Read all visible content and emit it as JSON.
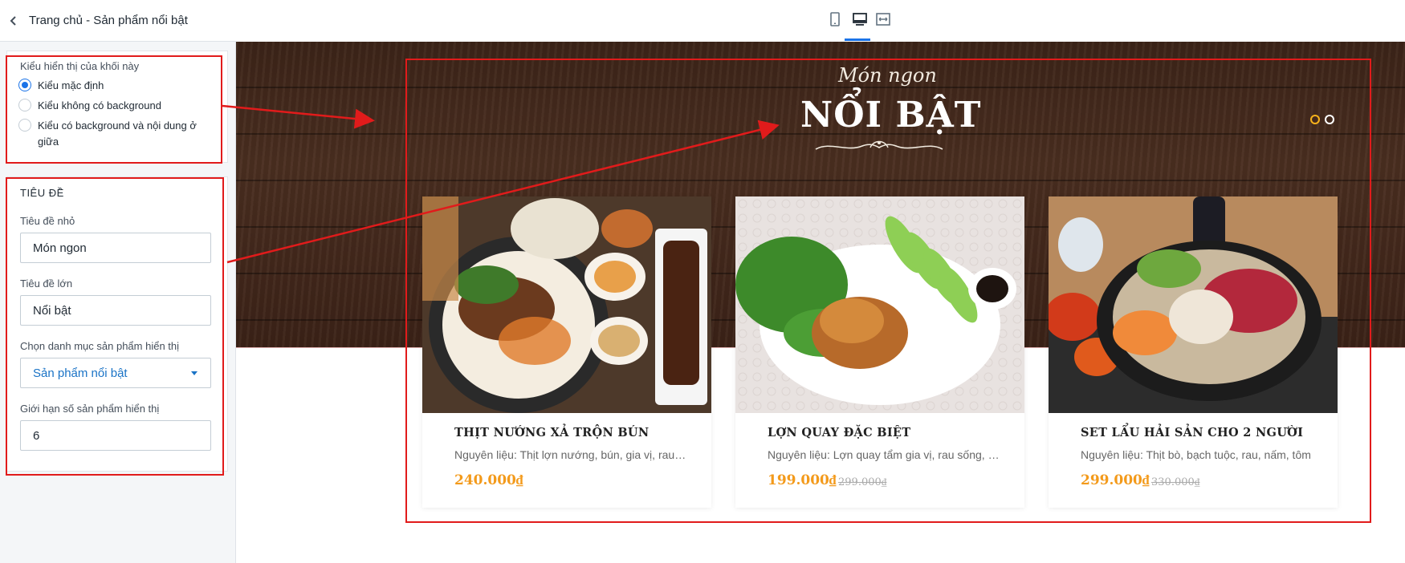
{
  "sidebar": {
    "back_icon": "chevron-left-icon",
    "title": "Trang chủ - Sản phẩm nổi bật",
    "display": {
      "label": "Kiểu hiển thị của khối này",
      "options": [
        {
          "label": "Kiểu mặc định",
          "checked": true
        },
        {
          "label": "Kiểu không có background",
          "checked": false
        },
        {
          "label": "Kiểu có background và nội dung ở giữa",
          "checked": false
        }
      ]
    },
    "title_section": {
      "heading": "TIÊU ĐỀ",
      "small_title_label": "Tiêu đề nhỏ",
      "small_title_value": "Món ngon",
      "large_title_label": "Tiêu đề lớn",
      "large_title_value": "Nổi bật",
      "category_label": "Chọn danh mục sản phẩm hiển thị",
      "category_value": "Sản phẩm nổi bật",
      "limit_label": "Giới hạn số sản phẩm hiển thị",
      "limit_value": "6"
    }
  },
  "devicebar": {
    "icons": [
      "mobile-icon",
      "desktop-icon",
      "fullwidth-icon"
    ],
    "active": "desktop-icon"
  },
  "preview": {
    "sub_title": "Món ngon",
    "main_title": "NỔI BẬT",
    "slider_dots": 2,
    "active_dot": 0,
    "products": [
      {
        "name": "THỊT NƯỚNG XẢ TRỘN BÚN",
        "desc": "Nguyên liệu: Thịt lợn nướng, bún, gia vị, rau thơm",
        "price": "240.000₫",
        "old_price": ""
      },
      {
        "name": "LỢN QUAY ĐẶC BIỆT",
        "desc": "Nguyên liệu: Lợn quay tẩm gia vị, rau sống, dưa chuột",
        "price": "199.000₫",
        "old_price": "299.000₫"
      },
      {
        "name": "SET LẨU HẢI SẢN CHO 2 NGƯỜI",
        "desc": "Nguyên liệu: Thịt bò, bạch tuộc, rau, nấm, tôm",
        "price": "299.000₫",
        "old_price": "330.000₫"
      }
    ]
  },
  "colors": {
    "accent": "#1a73e8",
    "price": "#f39a1b",
    "annotation": "#e11b1b",
    "wood": "#3c2418"
  }
}
